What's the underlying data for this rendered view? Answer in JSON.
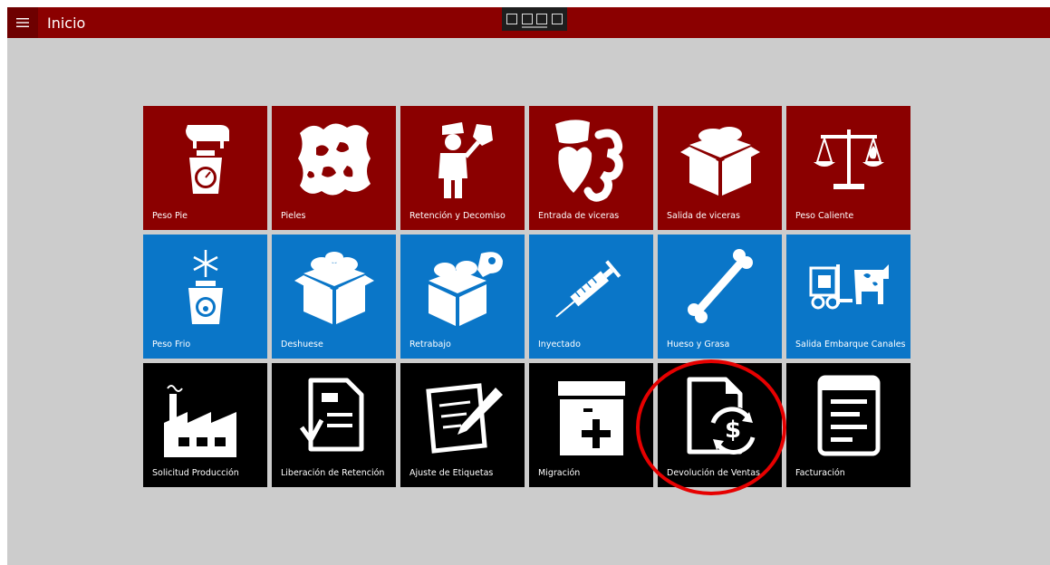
{
  "window": {
    "title": "Inicio"
  },
  "tiles": [
    {
      "label": "Peso Pie",
      "color": "#8b0000",
      "icon": "cow-scale-icon"
    },
    {
      "label": "Pieles",
      "color": "#8b0000",
      "icon": "hide-icon"
    },
    {
      "label": "Retención y Decomiso",
      "color": "#8b0000",
      "icon": "inspector-icon"
    },
    {
      "label": "Entrada de viceras",
      "color": "#8b0000",
      "icon": "organs-icon"
    },
    {
      "label": "Salida de viceras",
      "color": "#8b0000",
      "icon": "box-meat-icon"
    },
    {
      "label": "Peso Caliente",
      "color": "#8b0000",
      "icon": "balance-fire-icon"
    },
    {
      "label": "Peso Frio",
      "color": "#0a76c8",
      "icon": "snowflake-scale-icon"
    },
    {
      "label": "Deshuese",
      "color": "#0a76c8",
      "icon": "box-meat-icon"
    },
    {
      "label": "Retrabajo",
      "color": "#0a76c8",
      "icon": "box-meat-steak-icon"
    },
    {
      "label": "Inyectado",
      "color": "#0a76c8",
      "icon": "syringe-icon"
    },
    {
      "label": "Hueso y Grasa",
      "color": "#0a76c8",
      "icon": "bone-icon"
    },
    {
      "label": "Salida Embarque Canales",
      "color": "#0a76c8",
      "icon": "forklift-cow-icon"
    },
    {
      "label": "Solicitud Producción",
      "color": "#000000",
      "icon": "factory-icon"
    },
    {
      "label": "Liberación de Retención",
      "color": "#000000",
      "icon": "document-check-icon"
    },
    {
      "label": "Ajuste de Etiquetas",
      "color": "#000000",
      "icon": "document-pencil-icon"
    },
    {
      "label": "Migración",
      "color": "#000000",
      "icon": "box-plus-icon"
    },
    {
      "label": "Devolución de Ventas",
      "color": "#000000",
      "icon": "document-refund-icon"
    },
    {
      "label": "Facturación",
      "color": "#000000",
      "icon": "invoice-icon"
    }
  ],
  "highlight": {
    "color": "#e60000"
  }
}
